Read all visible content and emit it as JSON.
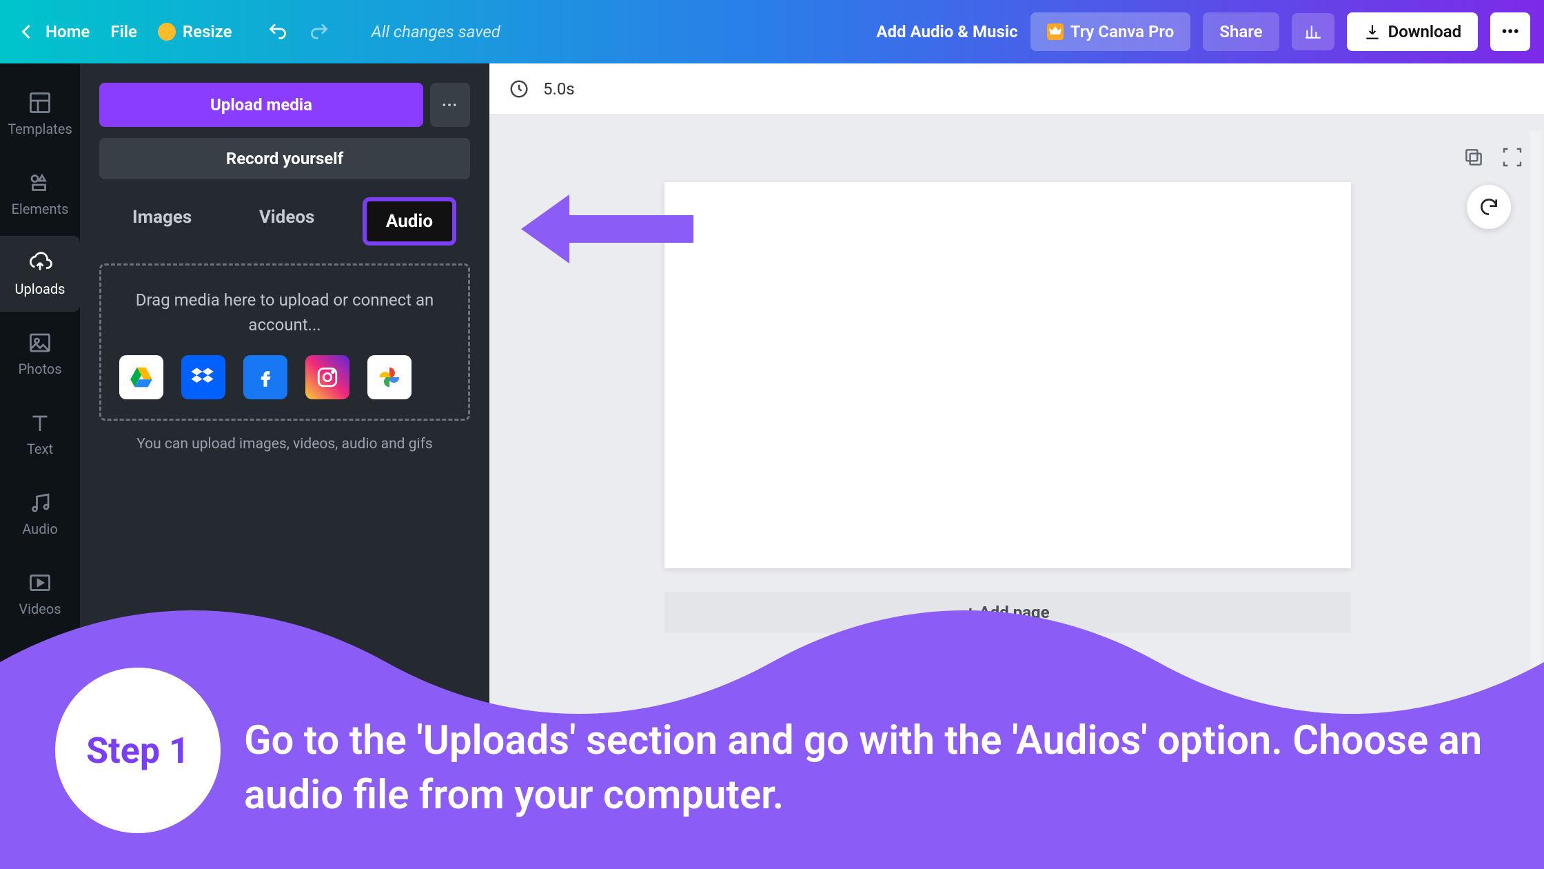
{
  "topbar": {
    "home": "Home",
    "file": "File",
    "resize": "Resize",
    "saved": "All changes saved",
    "title": "Add Audio & Music",
    "try_pro": "Try Canva Pro",
    "share": "Share",
    "download": "Download"
  },
  "rail": {
    "templates": "Templates",
    "elements": "Elements",
    "uploads": "Uploads",
    "photos": "Photos",
    "text": "Text",
    "audio": "Audio",
    "videos": "Videos"
  },
  "panel": {
    "upload": "Upload media",
    "record": "Record yourself",
    "tabs": {
      "images": "Images",
      "videos": "Videos",
      "audio": "Audio"
    },
    "drop_text": "Drag media here to upload or connect an account...",
    "hint": "You can upload images, videos, audio and gifs",
    "connectors": {
      "drive": "google-drive",
      "dropbox": "dropbox",
      "facebook": "facebook",
      "instagram": "instagram",
      "photos": "google-photos"
    }
  },
  "canvas": {
    "duration": "5.0s",
    "add_page": "+ Add page"
  },
  "overlay": {
    "step_label": "Step 1",
    "step_text": "Go to the 'Uploads' section and go with the 'Audios' option. Choose an audio file from your computer."
  }
}
